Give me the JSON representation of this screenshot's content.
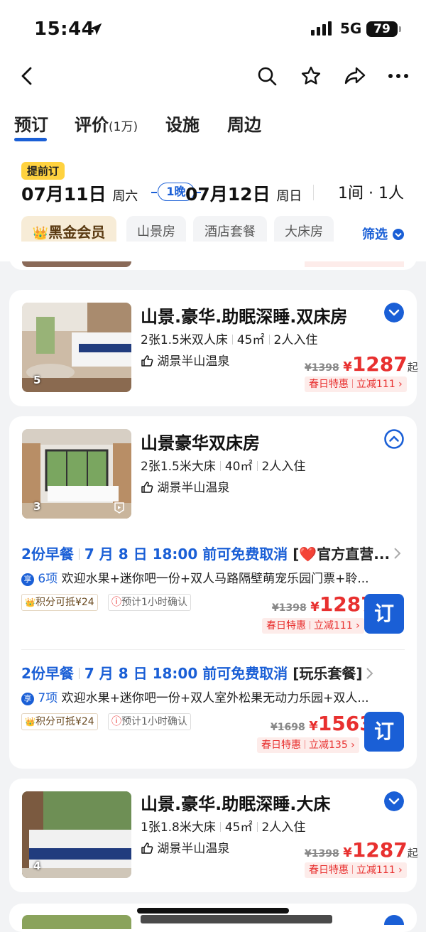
{
  "status": {
    "time": "15:44",
    "network": "5G",
    "battery": "79"
  },
  "tabs": [
    {
      "label": "预订",
      "count": ""
    },
    {
      "label": "评价",
      "count": "(1万)"
    },
    {
      "label": "设施",
      "count": ""
    },
    {
      "label": "周边",
      "count": ""
    }
  ],
  "booking": {
    "badge": "提前订",
    "checkin_date": "07月11日",
    "checkin_day": "周六",
    "nights": "1晚",
    "checkout_date": "07月12日",
    "checkout_day": "周日",
    "rooms_guests": "1间 · 1人"
  },
  "filters": {
    "chips": [
      "黑金会员",
      "山景房",
      "酒店套餐",
      "大床房"
    ],
    "filter_label": "筛选"
  },
  "rooms": [
    {
      "name": "山景.豪华.助眠深睡.双床房",
      "specs": [
        "2张1.5米双人床",
        "45㎡",
        "2人入住"
      ],
      "feature": "湖景半山温泉",
      "photo_count": "5",
      "old_price": "¥1398",
      "currency": "¥",
      "price": "1287",
      "suffix": "起",
      "promo": "春日特惠",
      "promo_off": "立减111 ›"
    },
    {
      "name": "山景豪华双床房",
      "specs": [
        "2张1.5米大床",
        "40㎡",
        "2人入住"
      ],
      "feature": "湖景半山温泉",
      "photo_count": "3",
      "offers": [
        {
          "breakfast": "2份早餐",
          "cancel": "7 月 8 日 18:00 前可免费取消",
          "package": "[❤️官方直营...",
          "benefit_icon": "享",
          "benefit_count": "6项",
          "benefits": "欢迎水果+迷你吧一份+双人马路隔壁萌宠乐园门票+聆...",
          "tag_points": "积分可抵¥24",
          "tag_confirm": "预计1小时确认",
          "old_price": "¥1398",
          "currency": "¥",
          "price": "1287",
          "promo": "春日特惠",
          "promo_off": "立减111 ›",
          "book": "订"
        },
        {
          "breakfast": "2份早餐",
          "cancel": "7 月 8 日 18:00 前可免费取消",
          "package": "[玩乐套餐]",
          "benefit_icon": "享",
          "benefit_count": "7项",
          "benefits": "欢迎水果+迷你吧一份+双人室外松果无动力乐园+双人...",
          "tag_points": "积分可抵¥24",
          "tag_confirm": "预计1小时确认",
          "old_price": "¥1698",
          "currency": "¥",
          "price": "1563",
          "promo": "春日特惠",
          "promo_off": "立减135 ›",
          "book": "订"
        }
      ]
    },
    {
      "name": "山景.豪华.助眠深睡.大床",
      "specs": [
        "1张1.8米大床",
        "45㎡",
        "2人入住"
      ],
      "feature": "湖景半山温泉",
      "photo_count": "4",
      "old_price": "¥1398",
      "currency": "¥",
      "price": "1287",
      "suffix": "起",
      "promo": "春日特惠",
      "promo_off": "立减111 ›"
    }
  ],
  "colors": {
    "accent": "#1a5fd6",
    "price": "#e8302f",
    "badge": "#ffd23f"
  }
}
